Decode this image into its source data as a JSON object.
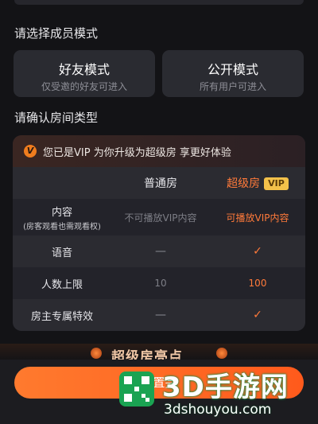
{
  "member_mode": {
    "title": "请选择成员模式",
    "options": [
      {
        "label": "好友模式",
        "desc": "仅受邀的好友可进入"
      },
      {
        "label": "公开模式",
        "desc": "所有用户可进入"
      }
    ]
  },
  "room_type": {
    "title": "请确认房间类型",
    "banner": "您已是VIP 为你升级为超级房 享更好体验",
    "banner_icon": "V",
    "columns": [
      "普通房",
      "超级房"
    ],
    "vip_tag": "VIP",
    "rows": [
      {
        "feature": "内容",
        "note": "(房客观看也需观看权)",
        "normal": "不可播放VIP内容",
        "super": "可播放VIP内容"
      },
      {
        "feature": "语音",
        "normal": "—",
        "super": "✓"
      },
      {
        "feature": "人数上限",
        "normal": "10",
        "super": "100"
      },
      {
        "feature": "房主专属特效",
        "normal": "—",
        "super": "✓"
      }
    ]
  },
  "highlights": {
    "title": "超级房亮点"
  },
  "footer": {
    "confirm_label": "设置完"
  },
  "watermark": {
    "title": "3D手游网",
    "url": "3dshouyou.com"
  },
  "colors": {
    "accent": "#ff7a3a",
    "vip_gold": "#f3c14a",
    "background": "#131316",
    "card": "#2a2b31"
  }
}
